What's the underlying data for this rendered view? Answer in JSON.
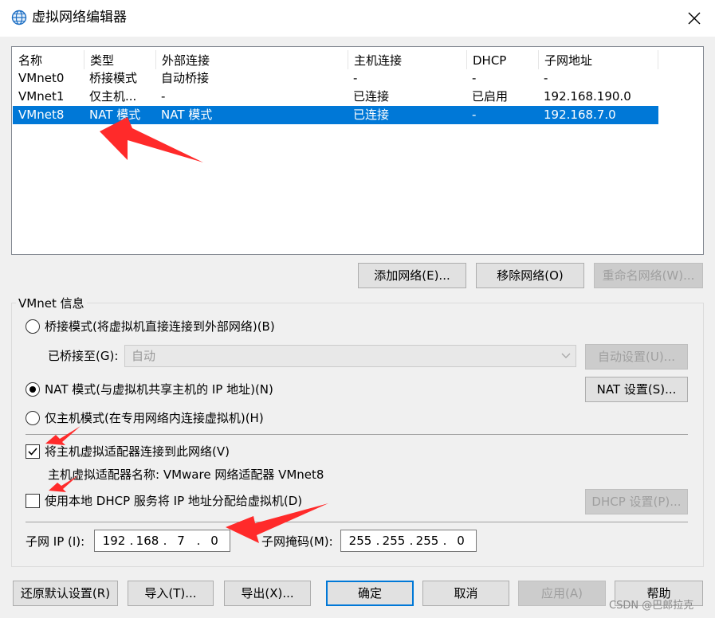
{
  "window": {
    "title": "虚拟网络编辑器",
    "icon": "globe-icon",
    "close_icon": "close-icon"
  },
  "network_list": {
    "columns": [
      "名称",
      "类型",
      "外部连接",
      "主机连接",
      "DHCP",
      "子网地址"
    ],
    "rows": [
      [
        "VMnet0",
        "桥接模式",
        "自动桥接",
        "-",
        "-",
        "-"
      ],
      [
        "VMnet1",
        "仅主机...",
        "-",
        "已连接",
        "已启用",
        "192.168.190.0"
      ],
      [
        "VMnet8",
        "NAT 模式",
        "NAT 模式",
        "已连接",
        "-",
        "192.168.7.0"
      ]
    ],
    "selected_row": 2
  },
  "list_buttons": {
    "add": "添加网络(E)...",
    "remove": "移除网络(O)",
    "rename": "重命名网络(W)..."
  },
  "vmnet_info": {
    "group_label": "VMnet 信息",
    "bridged_radio": "桥接模式(将虚拟机直接连接到外部网络)(B)",
    "bridged_to_label": "已桥接至(G):",
    "bridged_to_value": "自动",
    "auto_settings": "自动设置(U)...",
    "nat_radio": "NAT 模式(与虚拟机共享主机的 IP 地址)(N)",
    "nat_settings": "NAT 设置(S)...",
    "host_only_radio": "仅主机模式(在专用网络内连接虚拟机)(H)",
    "selected_mode": "nat",
    "connect_adapter_checkbox": "将主机虚拟适配器连接到此网络(V)",
    "connect_adapter_checked": true,
    "adapter_name": "主机虚拟适配器名称: VMware 网络适配器 VMnet8",
    "dhcp_checkbox": "使用本地 DHCP 服务将 IP 地址分配给虚拟机(D)",
    "dhcp_checked": false,
    "dhcp_settings": "DHCP 设置(P)...",
    "subnet_ip_label": "子网 IP (I):",
    "subnet_ip": [
      "192",
      "168",
      "7",
      "0"
    ],
    "subnet_mask_label": "子网掩码(M):",
    "subnet_mask": [
      "255",
      "255",
      "255",
      "0"
    ]
  },
  "footer_buttons": {
    "restore": "还原默认设置(R)",
    "import": "导入(T)...",
    "export": "导出(X)...",
    "ok": "确定",
    "cancel": "取消",
    "apply": "应用(A)",
    "help": "帮助"
  },
  "watermark": "CSDN @巴郎拉克",
  "colors": {
    "selection": "#0078d7",
    "annotation_arrow": "#ff2a2a",
    "window_bg": "#f0f0f0"
  }
}
